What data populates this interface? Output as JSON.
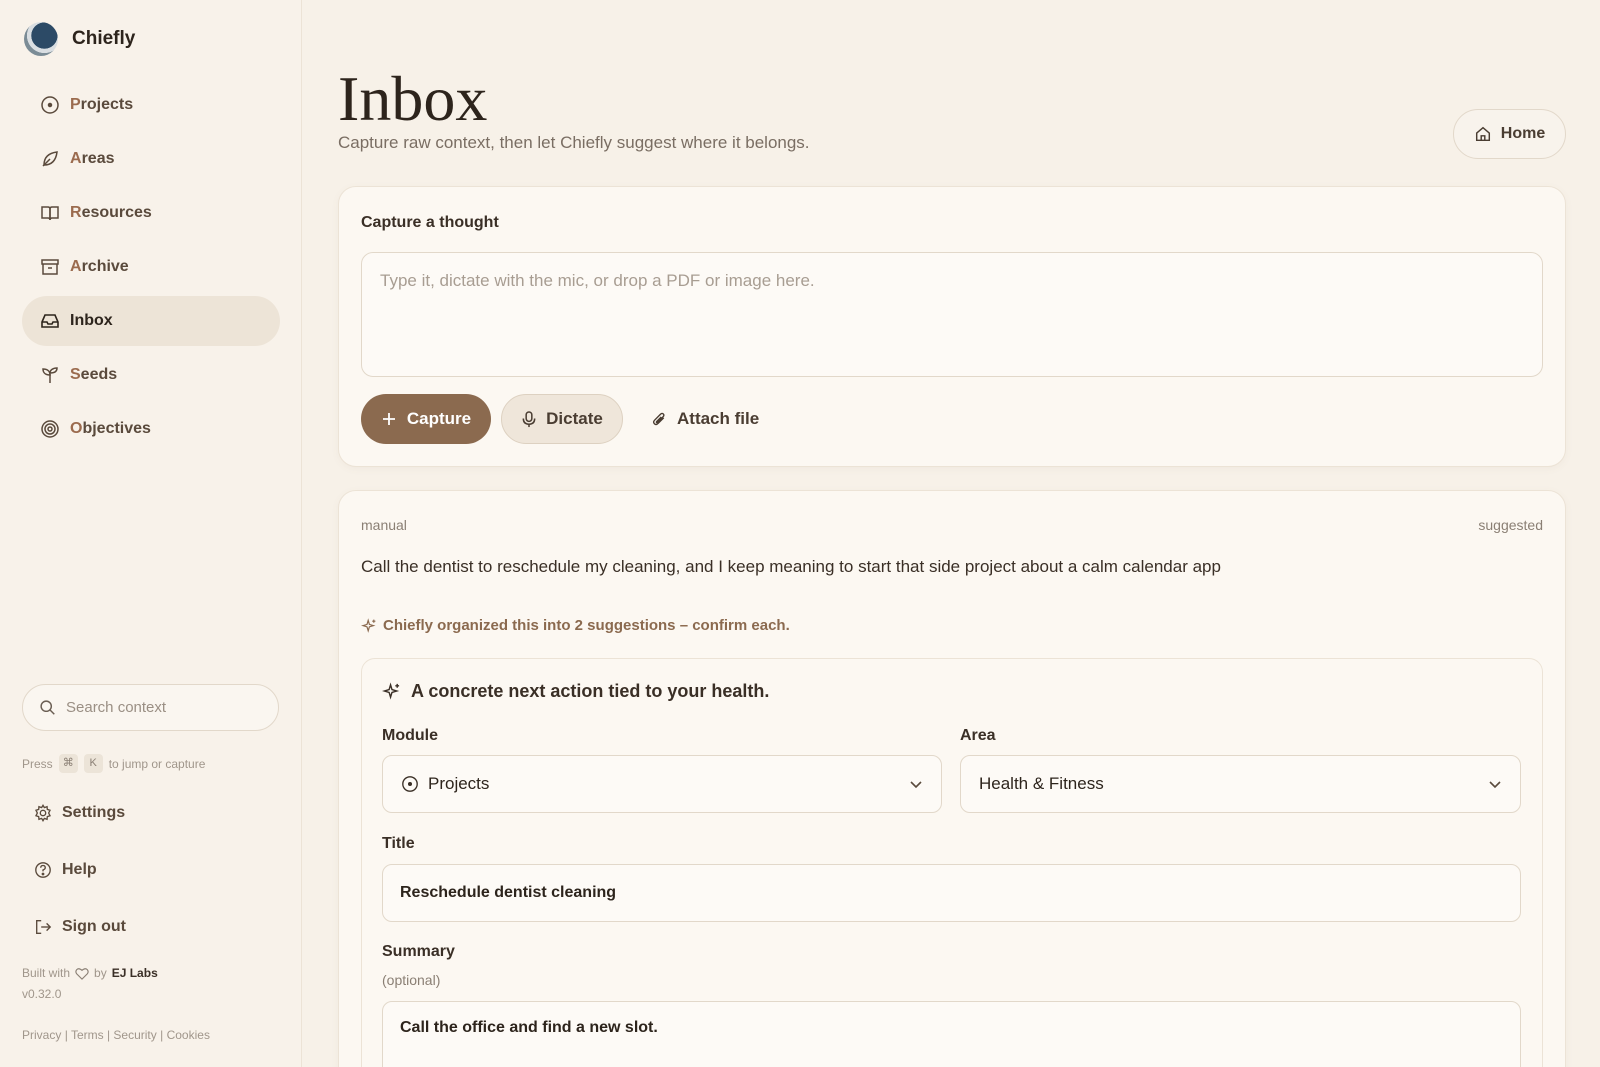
{
  "brand": {
    "name": "Chiefly"
  },
  "nav": {
    "items": [
      {
        "label": "Projects",
        "icon": "target-circle-icon"
      },
      {
        "label": "Areas",
        "icon": "leaf-icon"
      },
      {
        "label": "Resources",
        "icon": "book-icon"
      },
      {
        "label": "Archive",
        "icon": "archive-box-icon"
      },
      {
        "label": "Inbox",
        "icon": "inbox-icon",
        "active": true
      },
      {
        "label": "Seeds",
        "icon": "sprout-icon"
      },
      {
        "label": "Objectives",
        "icon": "bullseye-icon"
      }
    ]
  },
  "search": {
    "placeholder": "Search context"
  },
  "hint": {
    "prefix": "Press",
    "key1": "⌘",
    "key2": "K",
    "suffix": "to jump or capture"
  },
  "bottom_nav": {
    "settings": "Settings",
    "help": "Help",
    "signout": "Sign out"
  },
  "footer": {
    "built_prefix": "Built with",
    "built_by": "by",
    "company": "EJ Labs",
    "version": "v0.32.0",
    "privacy": "Privacy",
    "terms": "Terms",
    "security": "Security",
    "cookies": "Cookies",
    "sep": "|"
  },
  "page": {
    "title": "Inbox",
    "subtitle": "Capture raw context, then let Chiefly suggest where it belongs.",
    "home_label": "Home"
  },
  "capture": {
    "label": "Capture a thought",
    "placeholder": "Type it, dictate with the mic, or drop a PDF or image here.",
    "capture_btn": "Capture",
    "dictate_btn": "Dictate",
    "attach_btn": "Attach file"
  },
  "item": {
    "source": "manual",
    "status": "suggested",
    "text": "Call the dentist to reschedule my cleaning, and I keep meaning to start that side project about a calm calendar app",
    "ai_note": "Chiefly organized this into 2 suggestions – confirm each.",
    "suggestion": {
      "heading": "A concrete next action tied to your health.",
      "module_label": "Module",
      "module_value": "Projects",
      "area_label": "Area",
      "area_value": "Health & Fitness",
      "title_label": "Title",
      "title_value": "Reschedule dentist cleaning",
      "summary_label": "Summary",
      "summary_optional": "(optional)",
      "summary_value": "Call the office and find a new slot."
    }
  },
  "colors": {
    "accent": "#8b6a4f",
    "background": "#f7f1e8",
    "card": "#fcf8f2"
  }
}
